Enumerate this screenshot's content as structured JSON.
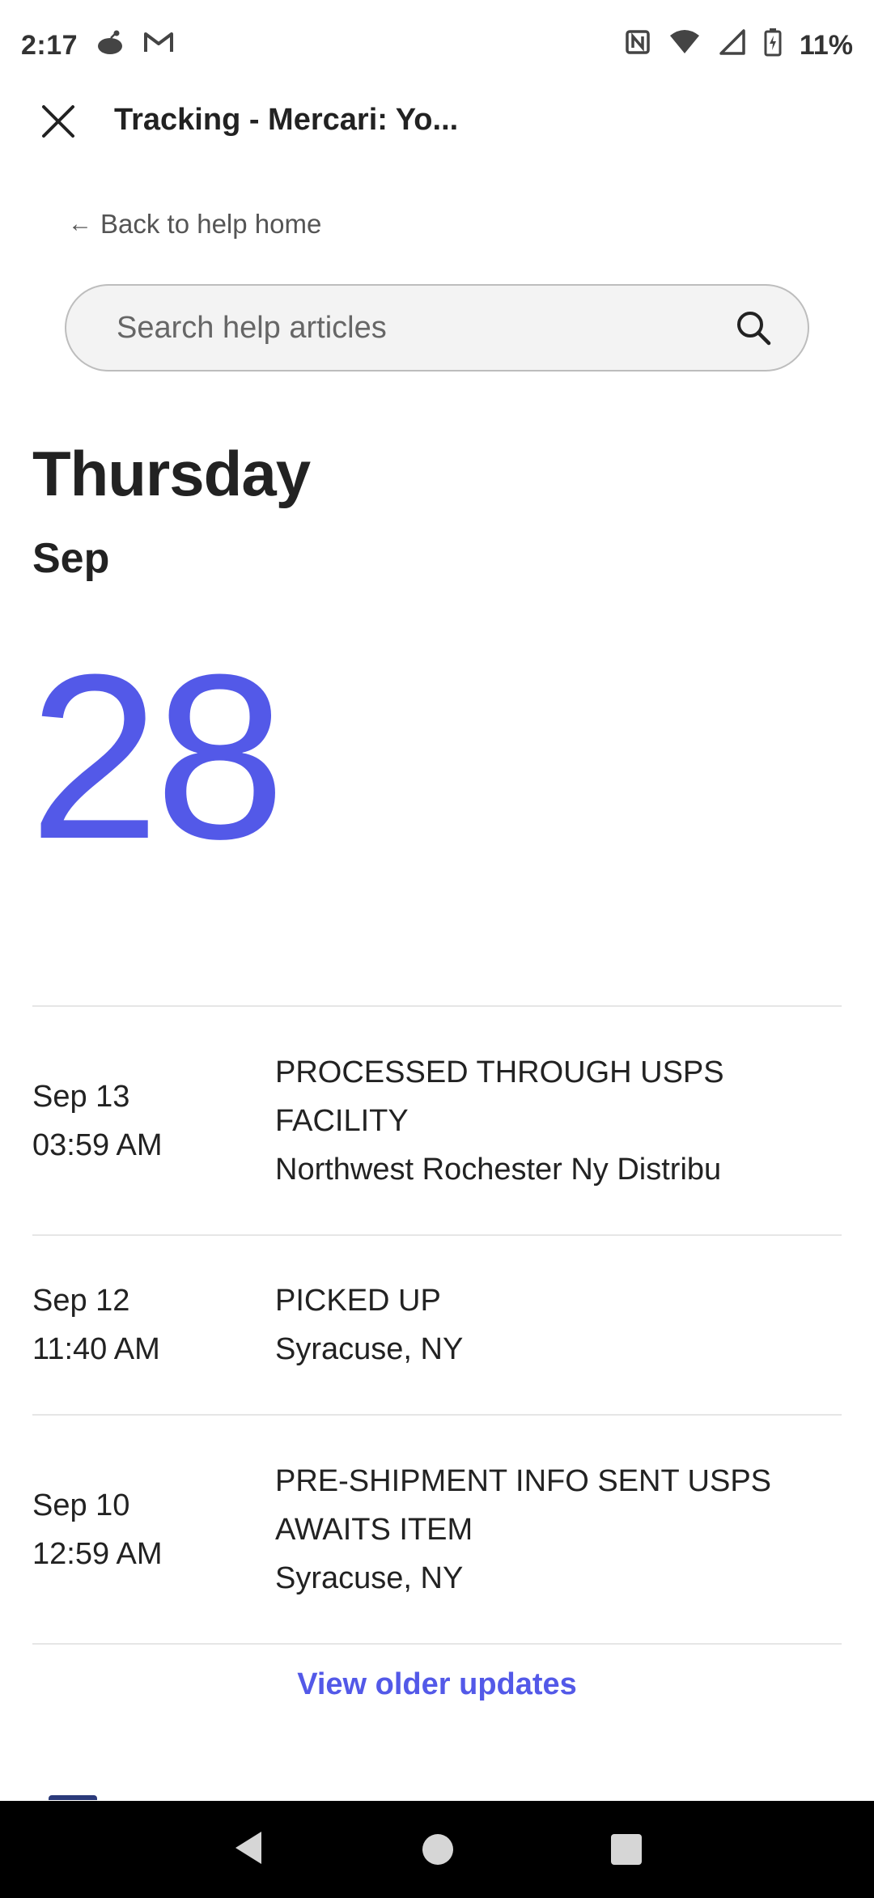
{
  "status_bar": {
    "time": "2:17",
    "battery": "11%",
    "icons_left": [
      "reddit-icon",
      "gmail-icon"
    ],
    "icons_right": [
      "nfc-icon",
      "wifi-icon",
      "signal-icon",
      "battery-charging-icon"
    ]
  },
  "app_bar": {
    "title": "Tracking - Mercari: Yo..."
  },
  "back_link": {
    "label": "Back to help home"
  },
  "search": {
    "placeholder": "Search help articles"
  },
  "delivery": {
    "weekday": "Thursday",
    "month": "Sep",
    "day": "28",
    "accent_color": "#5359e8"
  },
  "timeline": [
    {
      "date": "Sep 13",
      "time": "03:59 AM",
      "status_line1": "PROCESSED THROUGH USPS",
      "status_line2": "FACILITY",
      "location": "Northwest Rochester Ny Distribu"
    },
    {
      "date": "Sep 12",
      "time": "11:40 AM",
      "status_line1": "PICKED UP",
      "location": "Syracuse, NY"
    },
    {
      "date": "Sep 10",
      "time": "12:59 AM",
      "status_line1": "PRE-SHIPMENT INFO SENT USPS",
      "status_line2": "AWAITS ITEM",
      "location": "Syracuse, NY"
    }
  ],
  "view_older": {
    "label": "View older updates"
  }
}
